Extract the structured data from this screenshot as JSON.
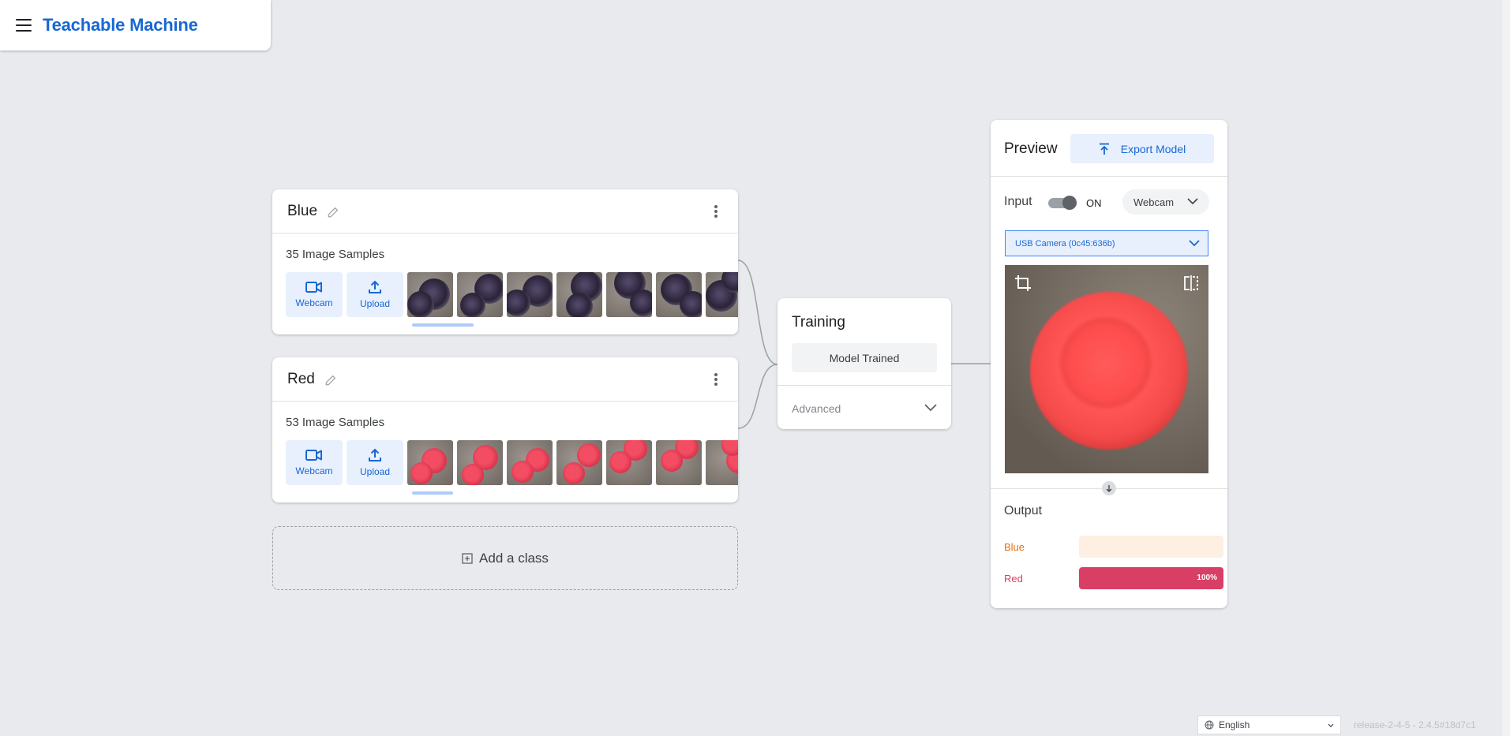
{
  "app": {
    "title": "Teachable Machine",
    "menu_icon": "menu-icon"
  },
  "classes": [
    {
      "name": "Blue",
      "sample_count": "35 Image Samples",
      "webcam_label": "Webcam",
      "upload_label": "Upload",
      "thumbnail_color": "blue"
    },
    {
      "name": "Red",
      "sample_count": "53 Image Samples",
      "webcam_label": "Webcam",
      "upload_label": "Upload",
      "thumbnail_color": "red"
    }
  ],
  "add_class": {
    "label": "Add a class"
  },
  "training": {
    "title": "Training",
    "button_label": "Model Trained",
    "advanced_label": "Advanced"
  },
  "preview": {
    "title": "Preview",
    "export_label": "Export Model",
    "input_label": "Input",
    "toggle_state": "ON",
    "source_select": "Webcam",
    "camera_select": "USB Camera (0c45:636b)",
    "output_label": "Output",
    "outputs": [
      {
        "name": "Blue",
        "value": 0,
        "percent_label": "",
        "color": "#e8710a",
        "track_color": "#feefe3"
      },
      {
        "name": "Red",
        "value": 100,
        "percent_label": "100%",
        "color": "#d93f65",
        "track_color": "#fce4ec"
      }
    ]
  },
  "footer": {
    "language": "English",
    "release": "release-2-4-5 - 2.4.5#18d7c1"
  },
  "colors": {
    "accent": "#1967d2",
    "background": "#e8eaed"
  }
}
